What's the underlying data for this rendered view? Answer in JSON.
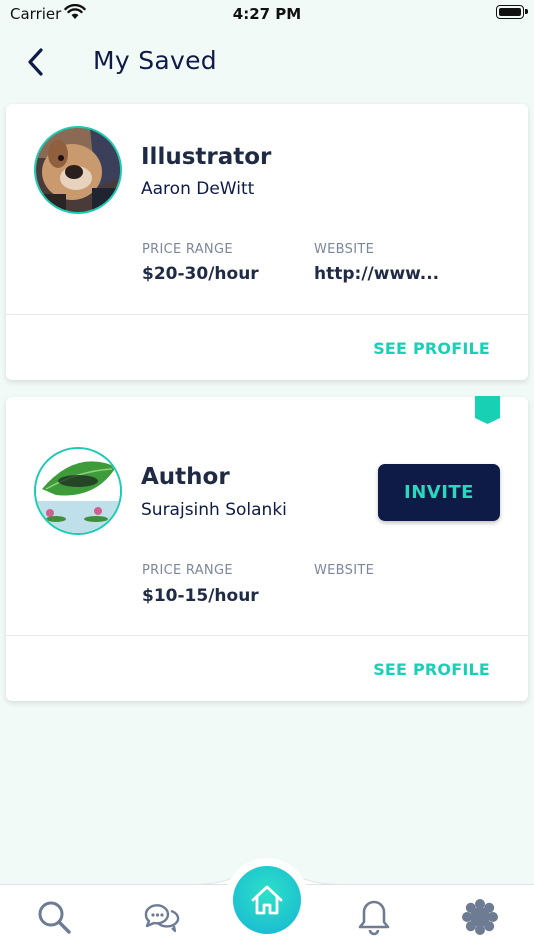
{
  "status_bar": {
    "carrier": "Carrier",
    "time": "4:27 PM"
  },
  "header": {
    "title": "My Saved"
  },
  "cards": [
    {
      "role": "Illustrator",
      "name": "Aaron DeWitt",
      "price_label": "PRICE RANGE",
      "price_value": "$20-30/hour",
      "website_label": "WEBSITE",
      "website_value": "http://www...",
      "see_profile": "SEE PROFILE"
    },
    {
      "role": "Author",
      "name": "Surajsinh Solanki",
      "price_label": "PRICE RANGE",
      "price_value": "$10-15/hour",
      "website_label": "WEBSITE",
      "website_value": "",
      "see_profile": "SEE PROFILE",
      "invite_label": "INVITE",
      "bookmarked": true
    }
  ],
  "tab_bar": {
    "tabs": [
      "search-icon",
      "chat-icon",
      "home-icon",
      "bell-icon",
      "gear-icon"
    ],
    "active": "home-icon"
  },
  "colors": {
    "accent": "#18d1b5",
    "navy": "#0d1b46",
    "background": "#f2faf7"
  }
}
